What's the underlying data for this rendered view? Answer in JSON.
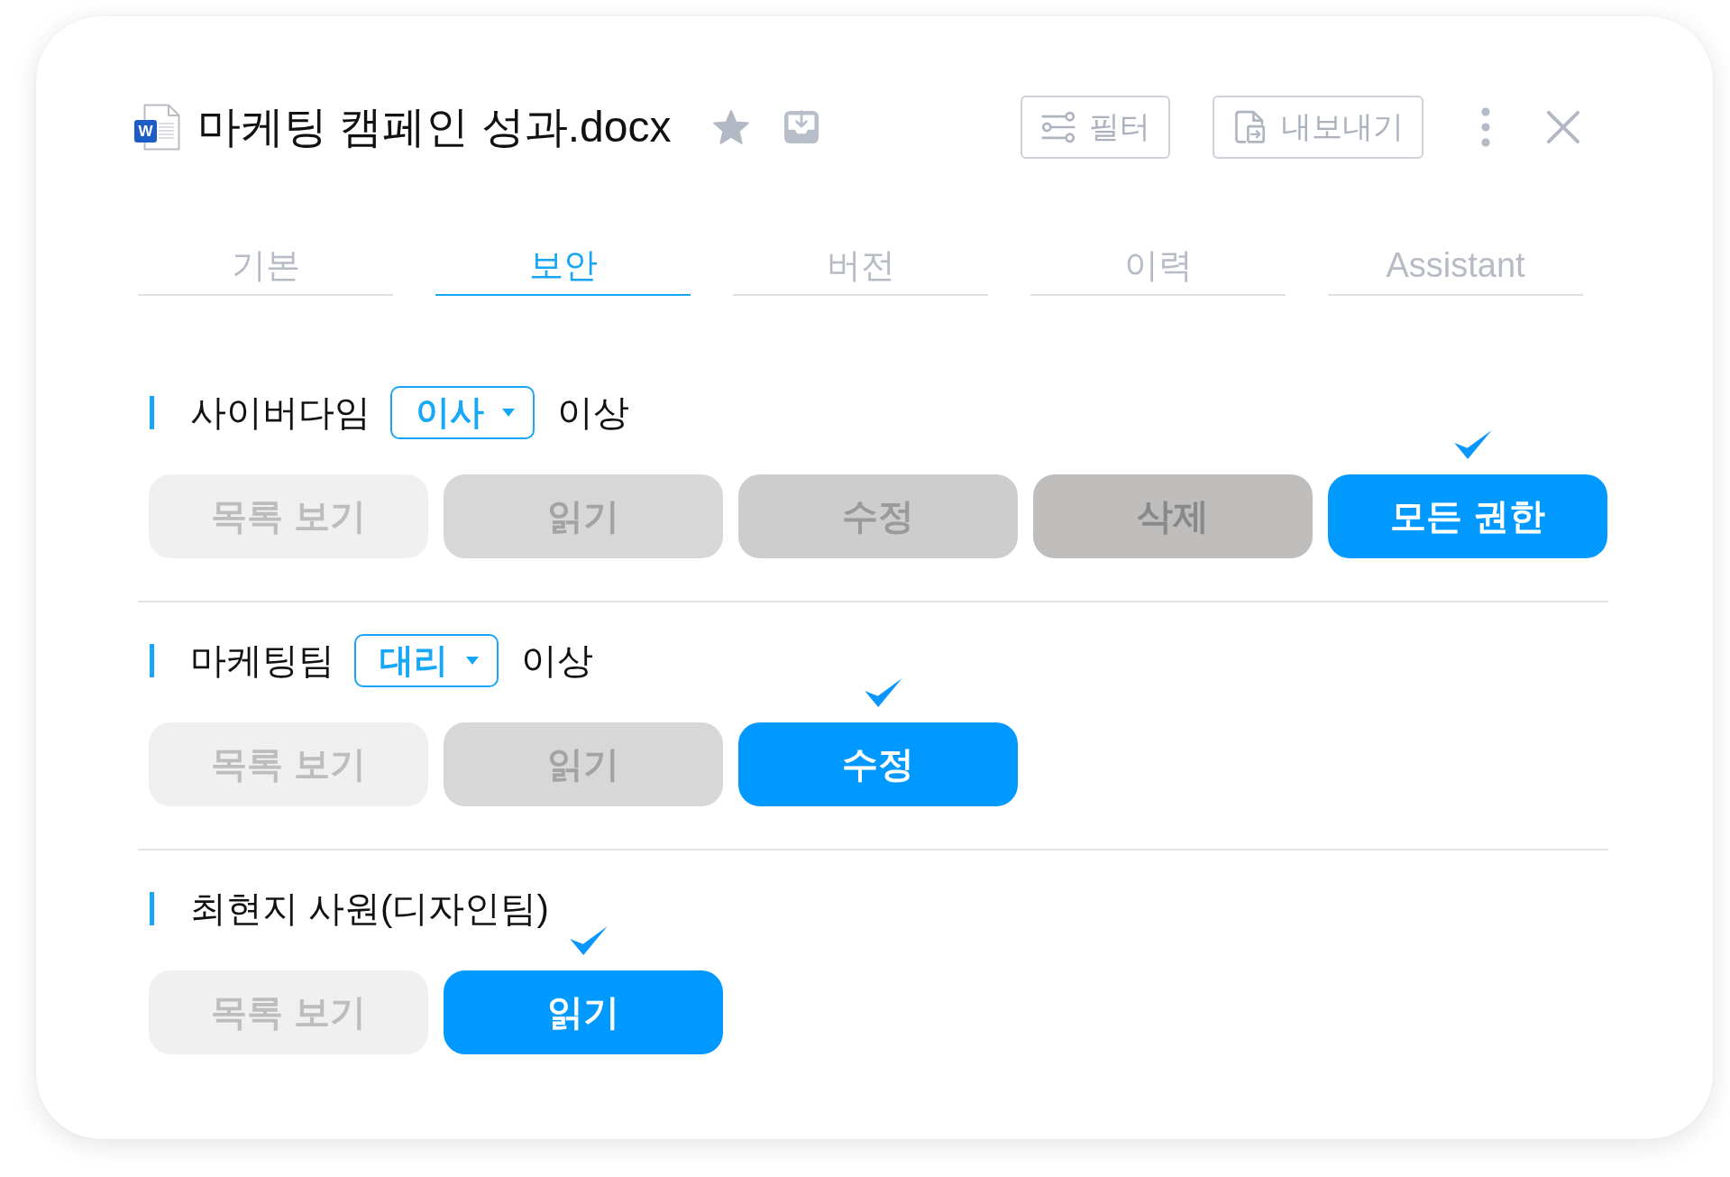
{
  "document": {
    "file_badge": "W",
    "title": "마케팅 캠페인 성과.docx"
  },
  "toolbar": [
    {
      "kind": "filter",
      "label": "필터"
    },
    {
      "kind": "export",
      "label": "내보내기"
    }
  ],
  "tabs": [
    {
      "label": "기본",
      "selected": false
    },
    {
      "label": "보안",
      "selected": true
    },
    {
      "label": "버전",
      "selected": false
    },
    {
      "label": "이력",
      "selected": false
    },
    {
      "label": "Assistant",
      "selected": false
    }
  ],
  "permission_groups": [
    {
      "name": "사이버다임",
      "rank": "이사",
      "rank_suffix": "이상",
      "permissions": [
        {
          "label": "목록 보기",
          "selected": false
        },
        {
          "label": "읽기",
          "selected": false
        },
        {
          "label": "수정",
          "selected": false
        },
        {
          "label": "삭제",
          "selected": false
        },
        {
          "label": "모든 권한",
          "selected": true
        }
      ]
    },
    {
      "name": "마케팅팀",
      "rank": "대리",
      "rank_suffix": "이상",
      "permissions": [
        {
          "label": "목록 보기",
          "selected": false
        },
        {
          "label": "읽기",
          "selected": false
        },
        {
          "label": "수정",
          "selected": true
        }
      ]
    },
    {
      "name": "최현지 사원(디자인팀)",
      "permissions": [
        {
          "label": "목록 보기",
          "selected": false
        },
        {
          "label": "읽기",
          "selected": true
        }
      ]
    }
  ]
}
